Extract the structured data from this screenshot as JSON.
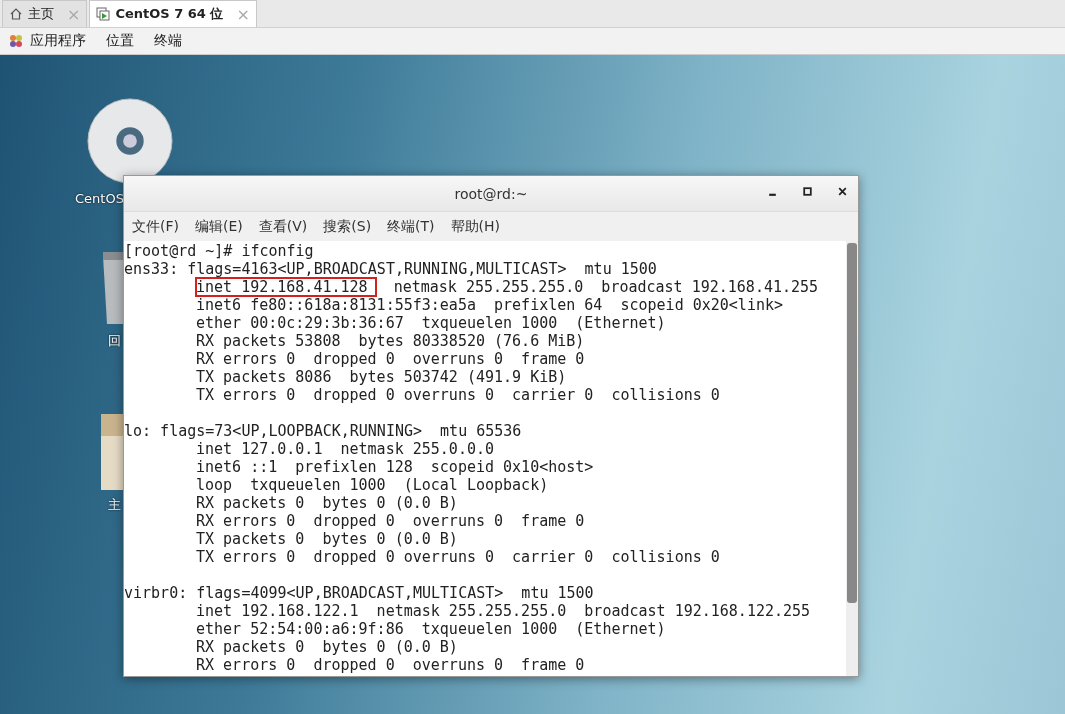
{
  "tabs": [
    {
      "label": "主页",
      "close": "×",
      "selected": false
    },
    {
      "label": "CentOS 7 64 位",
      "close": "×",
      "selected": true
    }
  ],
  "top_menu": [
    "应用程序",
    "位置",
    "终端"
  ],
  "desktop_icons": [
    {
      "kind": "disc",
      "label": "CentOS"
    },
    {
      "kind": "trash",
      "label": "回"
    },
    {
      "kind": "folder",
      "label": "主"
    }
  ],
  "terminal": {
    "title": "root@rd:~",
    "menu": [
      "文件(F)",
      "编辑(E)",
      "查看(V)",
      "搜索(S)",
      "终端(T)",
      "帮助(H)"
    ],
    "lines": [
      {
        "indented": false,
        "segments": [
          {
            "text": "[root@rd ~]# ifconfig",
            "boxed": false
          }
        ]
      },
      {
        "indented": false,
        "segments": [
          {
            "text": "ens33: flags=4163<UP,BROADCAST,RUNNING,MULTICAST>  mtu 1500",
            "boxed": false
          }
        ]
      },
      {
        "indented": true,
        "segments": [
          {
            "text": "inet 192.168.41.128",
            "boxed": true
          },
          {
            "text": "  netmask 255.255.255.0  broadcast 192.168.41.255",
            "boxed": false
          }
        ]
      },
      {
        "indented": true,
        "segments": [
          {
            "text": "inet6 fe80::618a:8131:55f3:ea5a  prefixlen 64  scopeid 0x20<link>",
            "boxed": false
          }
        ]
      },
      {
        "indented": true,
        "segments": [
          {
            "text": "ether 00:0c:29:3b:36:67  txqueuelen 1000  (Ethernet)",
            "boxed": false
          }
        ]
      },
      {
        "indented": true,
        "segments": [
          {
            "text": "RX packets 53808  bytes 80338520 (76.6 MiB)",
            "boxed": false
          }
        ]
      },
      {
        "indented": true,
        "segments": [
          {
            "text": "RX errors 0  dropped 0  overruns 0  frame 0",
            "boxed": false
          }
        ]
      },
      {
        "indented": true,
        "segments": [
          {
            "text": "TX packets 8086  bytes 503742 (491.9 KiB)",
            "boxed": false
          }
        ]
      },
      {
        "indented": true,
        "segments": [
          {
            "text": "TX errors 0  dropped 0 overruns 0  carrier 0  collisions 0",
            "boxed": false
          }
        ]
      },
      {
        "kind": "blank"
      },
      {
        "indented": false,
        "segments": [
          {
            "text": "lo: flags=73<UP,LOOPBACK,RUNNING>  mtu 65536",
            "boxed": false
          }
        ]
      },
      {
        "indented": true,
        "segments": [
          {
            "text": "inet 127.0.0.1  netmask 255.0.0.0",
            "boxed": false
          }
        ]
      },
      {
        "indented": true,
        "segments": [
          {
            "text": "inet6 ::1  prefixlen 128  scopeid 0x10<host>",
            "boxed": false
          }
        ]
      },
      {
        "indented": true,
        "segments": [
          {
            "text": "loop  txqueuelen 1000  (Local Loopback)",
            "boxed": false
          }
        ]
      },
      {
        "indented": true,
        "segments": [
          {
            "text": "RX packets 0  bytes 0 (0.0 B)",
            "boxed": false
          }
        ]
      },
      {
        "indented": true,
        "segments": [
          {
            "text": "RX errors 0  dropped 0  overruns 0  frame 0",
            "boxed": false
          }
        ]
      },
      {
        "indented": true,
        "segments": [
          {
            "text": "TX packets 0  bytes 0 (0.0 B)",
            "boxed": false
          }
        ]
      },
      {
        "indented": true,
        "segments": [
          {
            "text": "TX errors 0  dropped 0 overruns 0  carrier 0  collisions 0",
            "boxed": false
          }
        ]
      },
      {
        "kind": "blank"
      },
      {
        "indented": false,
        "segments": [
          {
            "text": "virbr0: flags=4099<UP,BROADCAST,MULTICAST>  mtu 1500",
            "boxed": false
          }
        ]
      },
      {
        "indented": true,
        "segments": [
          {
            "text": "inet 192.168.122.1  netmask 255.255.255.0  broadcast 192.168.122.255",
            "boxed": false
          }
        ]
      },
      {
        "indented": true,
        "segments": [
          {
            "text": "ether 52:54:00:a6:9f:86  txqueuelen 1000  (Ethernet)",
            "boxed": false
          }
        ]
      },
      {
        "indented": true,
        "segments": [
          {
            "text": "RX packets 0  bytes 0 (0.0 B)",
            "boxed": false
          }
        ]
      },
      {
        "indented": true,
        "segments": [
          {
            "text": "RX errors 0  dropped 0  overruns 0  frame 0",
            "boxed": false
          }
        ]
      }
    ]
  }
}
